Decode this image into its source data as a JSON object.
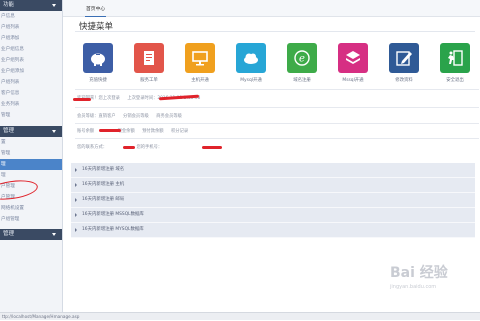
{
  "sidebar": {
    "section1": "功能",
    "section2": "管理",
    "section3": "管理",
    "items1": [
      "户信息",
      "户组列表",
      "户组添加",
      "业户组信息",
      "业户组列表",
      "业户组添加",
      "户组列表",
      "客户信息",
      "业务列表",
      "管理"
    ],
    "items2": [
      "置",
      "管理",
      "理",
      "理",
      "户管理",
      "户管理",
      "网络机设置",
      "户组管理"
    ],
    "active_index": 2
  },
  "topbar": {
    "home_tab": "首页中心"
  },
  "quick_menu": {
    "title": "快捷菜单",
    "tiles": [
      {
        "label": "充值快捷",
        "color": "#3d5ea6",
        "icon": "piggy-bank-icon"
      },
      {
        "label": "服务工单",
        "color": "#e2554a",
        "icon": "document-icon"
      },
      {
        "label": "主机开通",
        "color": "#f0a01e",
        "icon": "monitor-icon"
      },
      {
        "label": "Mysql开通",
        "color": "#27a6d6",
        "icon": "cloud-icon"
      },
      {
        "label": "域名注册",
        "color": "#3eab49",
        "icon": "e-letter-icon"
      },
      {
        "label": "Mssql开通",
        "color": "#d62f83",
        "icon": "layers-icon"
      },
      {
        "label": "修改资料",
        "color": "#2f5a96",
        "icon": "edit-icon"
      },
      {
        "label": "安全退出",
        "color": "#2aa34b",
        "icon": "exit-icon"
      }
    ]
  },
  "info": {
    "line1": [
      "欢迎回来！您上次登录",
      "上次登录时间：2016-11-11 2:05:08"
    ],
    "line2": [
      "会员等级：直销客户",
      "分销会员等级",
      "商务会员等级"
    ],
    "line3": [
      "账号余额",
      "现金余额",
      "预付款余额",
      "积分记录"
    ],
    "line4": [
      "您的联系方式：",
      "您的手机号："
    ]
  },
  "notices": [
    "16天内新增注册 域名",
    "16天内新增注册 主机",
    "16天内新增注册 邮局",
    "16天内新增注册 MSSQL数据库",
    "16天内新增注册 MYSQL数据库"
  ],
  "watermark": {
    "brand": "Bai 经验",
    "sub": "jingyan.baidu.com"
  },
  "status": {
    "text": "ttp://localhost/Manage/Hmanage.asp"
  }
}
